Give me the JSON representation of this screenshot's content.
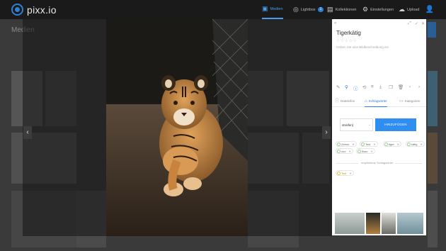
{
  "app": {
    "logo_text": "pixx.io"
  },
  "nav": {
    "items": [
      {
        "label": "Medien",
        "icon": "images-icon",
        "active": true
      },
      {
        "label": "Lightbox",
        "icon": "lightbulb-icon",
        "badge": "1"
      },
      {
        "label": "Kollektionen",
        "icon": "collections-icon"
      },
      {
        "label": "Einstellungen",
        "icon": "gear-icon"
      },
      {
        "label": "Upload",
        "icon": "cloud-upload-icon"
      }
    ],
    "user_icon": "user-icon"
  },
  "background": {
    "title": "Medien"
  },
  "detail": {
    "title": "Tigerkätig",
    "stars": "☆☆☆☆☆",
    "description_placeholder": "Geben Sie eine Bildbeschreibung ein",
    "tabs": [
      {
        "label": "Dateiinfos",
        "icon": "info-icon"
      },
      {
        "label": "Schlagwörter",
        "icon": "tag-icon",
        "active": true
      },
      {
        "label": "Kategorien",
        "icon": "folder-icon"
      }
    ],
    "keyword_input_value": "streifen|",
    "add_button_label": "HINZUFÜGEN",
    "keywords": [
      "Zernin",
      "Test",
      "tiger",
      "käfig",
      "zoo",
      "Baro"
    ],
    "suggested_label": "empfohlene Schlagwörter",
    "suggested": [
      "Test"
    ]
  }
}
